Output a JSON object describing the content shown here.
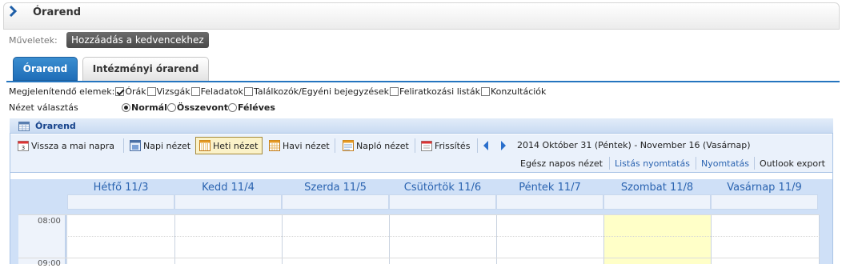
{
  "page": {
    "title": "Órarend"
  },
  "actions": {
    "label": "Műveletek:",
    "favorite_button": "Hozzáadás a kedvencekhez"
  },
  "tabs": [
    {
      "label": "Órarend",
      "active": true
    },
    {
      "label": "Intézményi órarend",
      "active": false
    }
  ],
  "elements": {
    "label": "Megjelenítendő elemek:",
    "items": [
      {
        "label": "Órák",
        "checked": true
      },
      {
        "label": "Vizsgák",
        "checked": false
      },
      {
        "label": "Feladatok",
        "checked": false
      },
      {
        "label": "Találkozók/Egyéni bejegyzések",
        "checked": false
      },
      {
        "label": "Feliratkozási listák",
        "checked": false
      },
      {
        "label": "Konzultációk",
        "checked": false
      }
    ]
  },
  "view": {
    "label": "Nézet választás",
    "options": [
      {
        "label": "Normál",
        "selected": true
      },
      {
        "label": "Összevont",
        "selected": false
      },
      {
        "label": "Féléves",
        "selected": false
      }
    ]
  },
  "calendar": {
    "title": "Órarend",
    "toolbar": {
      "today": "Vissza a mai napra",
      "daily": "Napi nézet",
      "weekly": "Heti nézet",
      "monthly": "Havi nézet",
      "journal": "Napló nézet",
      "refresh": "Frissítés",
      "date_range": "2014 Október 31 (Péntek) - November 16 (Vasárnap)",
      "all_day": "Egész napos nézet",
      "list_print": "Listás nyomtatás",
      "print": "Nyomtatás",
      "outlook": "Outlook export"
    },
    "days": [
      "Hétfő 11/3",
      "Kedd 11/4",
      "Szerda 11/5",
      "Csütörtök 11/6",
      "Péntek 11/7",
      "Szombat 11/8",
      "Vasárnap 11/9"
    ],
    "times": [
      "08:00",
      "09:00"
    ],
    "colors": {
      "accent": "#2575bf",
      "link": "#2a63b0",
      "saturday": "#ffffc8"
    }
  }
}
